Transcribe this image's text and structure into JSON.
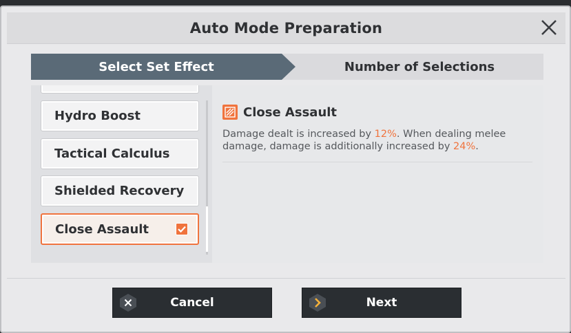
{
  "dialog": {
    "title": "Auto Mode Preparation",
    "close_icon": "close-icon"
  },
  "tabs": [
    {
      "label": "Select Set Effect",
      "active": true
    },
    {
      "label": "Number of Selections",
      "active": false
    }
  ],
  "list": {
    "items": [
      {
        "label": ""
      },
      {
        "label": "Hydro Boost"
      },
      {
        "label": "Tactical Calculus"
      },
      {
        "label": "Shielded Recovery"
      },
      {
        "label": "Close Assault",
        "selected": true,
        "checked": true
      }
    ]
  },
  "detail": {
    "icon": "close-assault-icon",
    "title": "Close Assault",
    "desc_parts": {
      "p1": "Damage dealt is increased by ",
      "v1": "12%",
      "p2": ". When dealing melee damage, damage is additionally increased by ",
      "v2": "24%",
      "p3": "."
    }
  },
  "buttons": {
    "cancel": {
      "label": "Cancel",
      "icon": "x-icon"
    },
    "next": {
      "label": "Next",
      "icon": "chevron-right-icon"
    }
  },
  "colors": {
    "accent": "#f0733d",
    "tab_active": "#5a6a77",
    "button_dark": "#2a2e32"
  }
}
